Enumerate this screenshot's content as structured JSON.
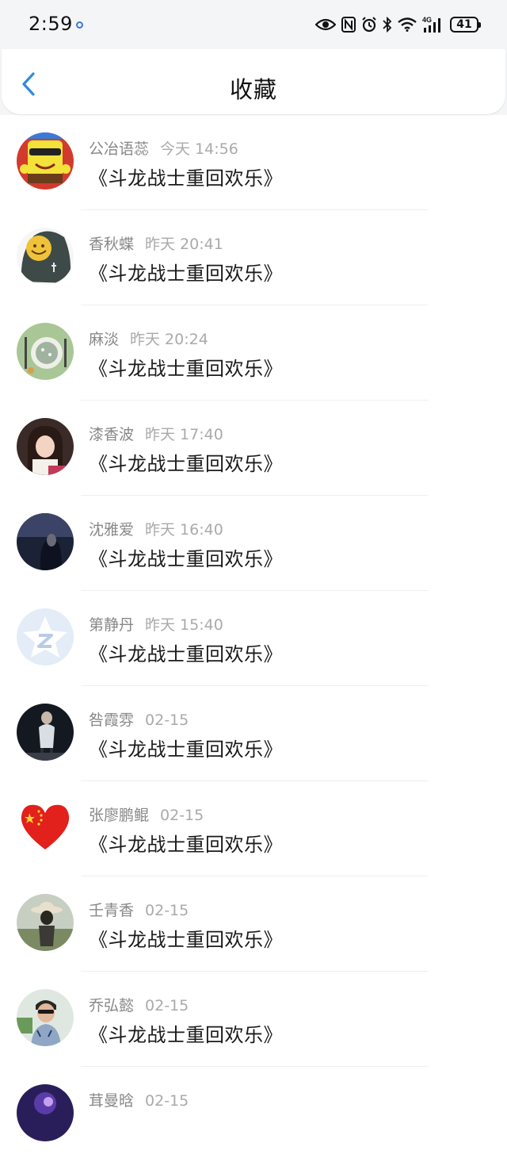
{
  "status_bar": {
    "time": "2:59",
    "battery": "41",
    "network": "4G"
  },
  "header": {
    "title": "收藏"
  },
  "favorites": [
    {
      "name": "公冶语蕊",
      "time": "今天 14:56",
      "content": "《斗龙战士重回欢乐》",
      "avatar": "sponge-avatar"
    },
    {
      "name": "香秋蝶",
      "time": "昨天 20:41",
      "content": "《斗龙战士重回欢乐》",
      "avatar": "smiley-avatar"
    },
    {
      "name": "麻淡",
      "time": "昨天 20:24",
      "content": "《斗龙战士重回欢乐》",
      "avatar": "plate-avatar"
    },
    {
      "name": "漆香波",
      "time": "昨天 17:40",
      "content": "《斗龙战士重回欢乐》",
      "avatar": "girl-photo-avatar"
    },
    {
      "name": "沈雅爱",
      "time": "昨天 16:40",
      "content": "《斗龙战士重回欢乐》",
      "avatar": "dark-photo-avatar"
    },
    {
      "name": "第静丹",
      "time": "昨天 15:40",
      "content": "《斗龙战士重回欢乐》",
      "avatar": "default-qq-avatar"
    },
    {
      "name": "咎霞雰",
      "time": "02-15",
      "content": "《斗龙战士重回欢乐》",
      "avatar": "silhouette-avatar"
    },
    {
      "name": "张廖鹏鲲",
      "time": "02-15",
      "content": "《斗龙战士重回欢乐》",
      "avatar": "heart-flag-avatar"
    },
    {
      "name": "壬青香",
      "time": "02-15",
      "content": "《斗龙战士重回欢乐》",
      "avatar": "hat-photo-avatar"
    },
    {
      "name": "乔弘懿",
      "time": "02-15",
      "content": "《斗龙战士重回欢乐》",
      "avatar": "boy-photo-avatar"
    },
    {
      "name": "茸曼晗",
      "time": "02-15",
      "content": "",
      "avatar": "purple-photo-avatar"
    }
  ],
  "colors": {
    "accent": "#2f8ae0",
    "meta_text": "#888888",
    "content_text": "#1a1a1a",
    "header_bg": "#ffffff",
    "top_bg": "#f4f5f7"
  }
}
